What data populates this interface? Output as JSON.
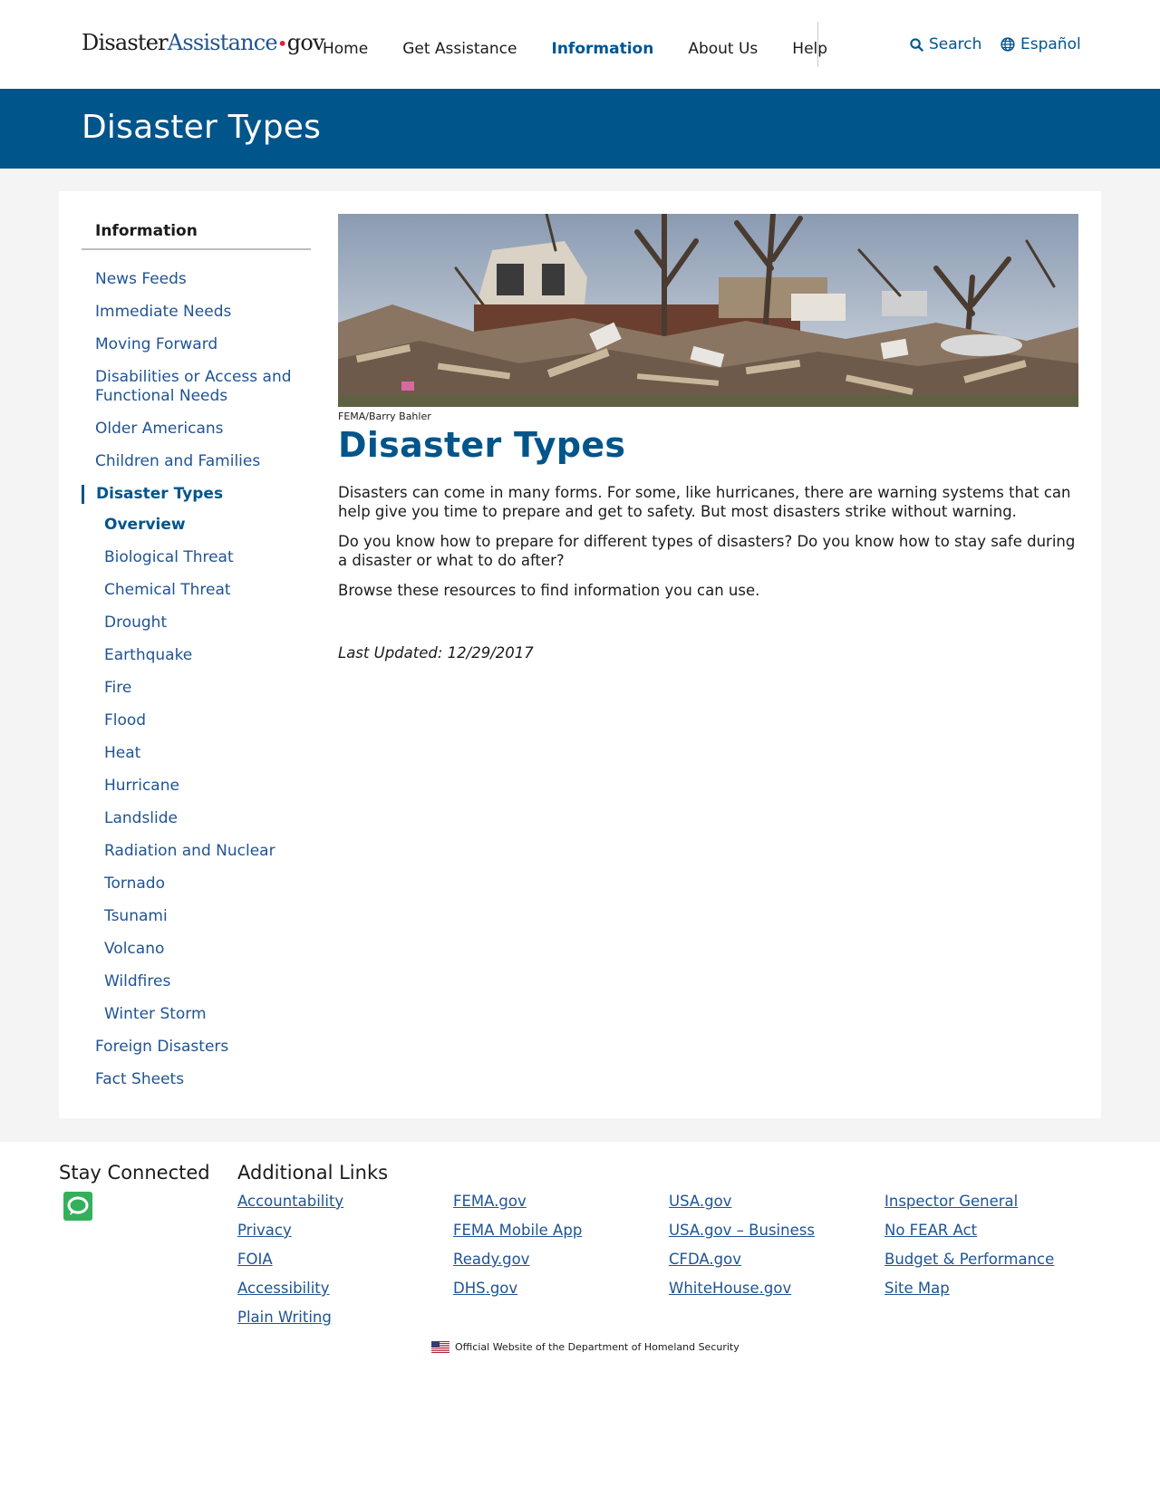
{
  "logo": {
    "part1": "Disaster",
    "part2": "Assistance",
    "dot": "•",
    "part3": "gov"
  },
  "nav": [
    "Home",
    "Get Assistance",
    "Information",
    "About Us",
    "Help"
  ],
  "nav_active_index": 2,
  "utility": {
    "search": "Search",
    "language": "Español"
  },
  "banner_title": "Disaster Types",
  "sidenav": {
    "title": "Information",
    "items_before": [
      "News Feeds",
      "Immediate Needs",
      "Moving Forward",
      "Disabilities or Access and Functional Needs",
      "Older Americans",
      "Children and Families"
    ],
    "current": "Disaster Types",
    "subitems": [
      "Overview",
      "Biological Threat",
      "Chemical Threat",
      "Drought",
      "Earthquake",
      "Fire",
      "Flood",
      "Heat",
      "Hurricane",
      "Landslide",
      "Radiation and Nuclear",
      "Tornado",
      "Tsunami",
      "Volcano",
      "Wildfires",
      "Winter Storm"
    ],
    "items_after": [
      "Foreign Disasters",
      "Fact Sheets"
    ]
  },
  "content": {
    "photo_credit": "FEMA/Barry Bahler",
    "title": "Disaster Types",
    "paragraphs": [
      "Disasters can come in many forms. For some, like hurricanes, there are warning systems that can help give you time to prepare and get to safety. But most disasters strike without warning.",
      "Do you know how to prepare for different types of disasters? Do you know how to stay safe during a disaster or what to do after?",
      "Browse these resources to find information you can use."
    ],
    "last_updated": "Last Updated: 12/29/2017"
  },
  "footer": {
    "stay_connected": "Stay Connected",
    "additional_links": "Additional Links",
    "columns": [
      [
        "Accountability",
        "Privacy",
        "FOIA",
        "Accessibility",
        "Plain Writing"
      ],
      [
        "FEMA.gov",
        "FEMA Mobile App",
        "Ready.gov",
        "DHS.gov"
      ],
      [
        "USA.gov",
        "USA.gov – Business",
        "CFDA.gov",
        "WhiteHouse.gov"
      ],
      [
        "Inspector General",
        "No FEAR Act",
        "Budget & Performance",
        "Site Map"
      ]
    ],
    "official": "Official Website of the Department of Homeland Security"
  },
  "colors": {
    "brand_blue": "#00558b",
    "link_blue": "#205493",
    "logo_red": "#e31c3d",
    "social_green": "#34b05b"
  },
  "icons": {
    "search": "search-icon",
    "language": "globe-icon",
    "social": "chat-icon",
    "official": "us-flag-icon"
  }
}
